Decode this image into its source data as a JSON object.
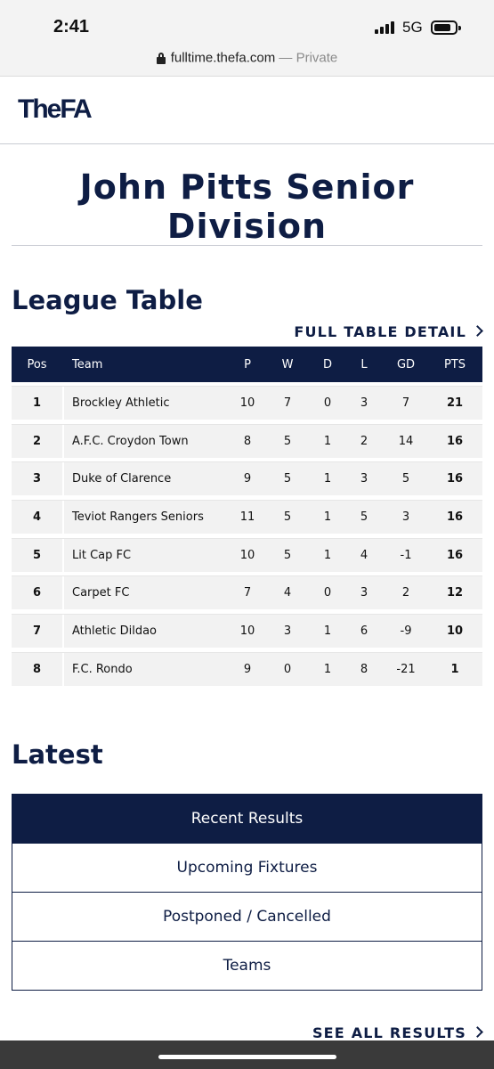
{
  "status_bar": {
    "time": "2:41",
    "network": "5G",
    "battery_level": 0.8
  },
  "browser": {
    "domain": "fulltime.thefa.com",
    "separator": "—",
    "mode": "Private",
    "lock_icon": "lock-icon"
  },
  "header": {
    "logo": "TheFA"
  },
  "page": {
    "title": "John Pitts Senior Division"
  },
  "league_table": {
    "heading": "League Table",
    "full_detail_link": "FULL TABLE DETAIL",
    "columns": [
      "Pos",
      "Team",
      "P",
      "W",
      "D",
      "L",
      "GD",
      "PTS"
    ],
    "rows": [
      {
        "pos": "1",
        "team": "Brockley Athletic",
        "p": "10",
        "w": "7",
        "d": "0",
        "l": "3",
        "gd": "7",
        "pts": "21"
      },
      {
        "pos": "2",
        "team": "A.F.C. Croydon Town",
        "p": "8",
        "w": "5",
        "d": "1",
        "l": "2",
        "gd": "14",
        "pts": "16"
      },
      {
        "pos": "3",
        "team": "Duke of Clarence",
        "p": "9",
        "w": "5",
        "d": "1",
        "l": "3",
        "gd": "5",
        "pts": "16"
      },
      {
        "pos": "4",
        "team": "Teviot Rangers Seniors",
        "p": "11",
        "w": "5",
        "d": "1",
        "l": "5",
        "gd": "3",
        "pts": "16"
      },
      {
        "pos": "5",
        "team": "Lit Cap FC",
        "p": "10",
        "w": "5",
        "d": "1",
        "l": "4",
        "gd": "-1",
        "pts": "16"
      },
      {
        "pos": "6",
        "team": "Carpet FC",
        "p": "7",
        "w": "4",
        "d": "0",
        "l": "3",
        "gd": "2",
        "pts": "12"
      },
      {
        "pos": "7",
        "team": "Athletic Dildao",
        "p": "10",
        "w": "3",
        "d": "1",
        "l": "6",
        "gd": "-9",
        "pts": "10"
      },
      {
        "pos": "8",
        "team": "F.C. Rondo",
        "p": "9",
        "w": "0",
        "d": "1",
        "l": "8",
        "gd": "-21",
        "pts": "1"
      }
    ]
  },
  "latest": {
    "heading": "Latest",
    "tabs": [
      {
        "label": "Recent Results",
        "active": true
      },
      {
        "label": "Upcoming Fixtures",
        "active": false
      },
      {
        "label": "Postponed / Cancelled",
        "active": false
      },
      {
        "label": "Teams",
        "active": false
      }
    ],
    "see_all_link": "SEE ALL RESULTS"
  },
  "colors": {
    "navy": "#0e1d44",
    "row_bg": "#f2f2f2"
  }
}
